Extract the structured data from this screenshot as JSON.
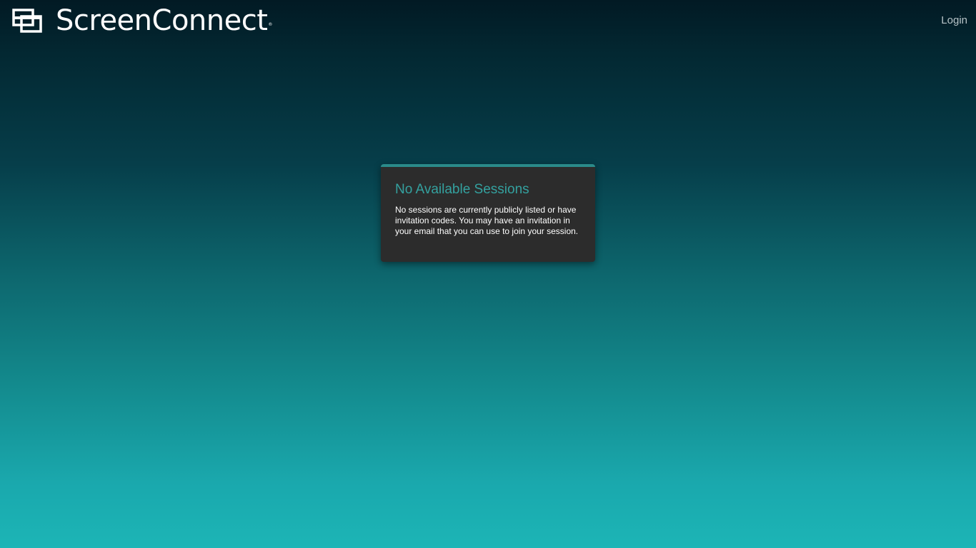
{
  "header": {
    "logo_text": "ScreenConnect",
    "logo_registered": "®",
    "logo_icon": "screenconnect-logo-icon",
    "login_label": "Login"
  },
  "panel": {
    "title": "No Available Sessions",
    "message": "No sessions are currently publicly listed or have invitation codes. You may have an invitation in your email that you can use to join your session."
  },
  "colors": {
    "accent": "#34a19f",
    "panel_background": "#2c2c2c",
    "panel_border": "#2a8b8a",
    "gradient_top": "#021a24",
    "gradient_bottom": "#1cb5b6"
  }
}
